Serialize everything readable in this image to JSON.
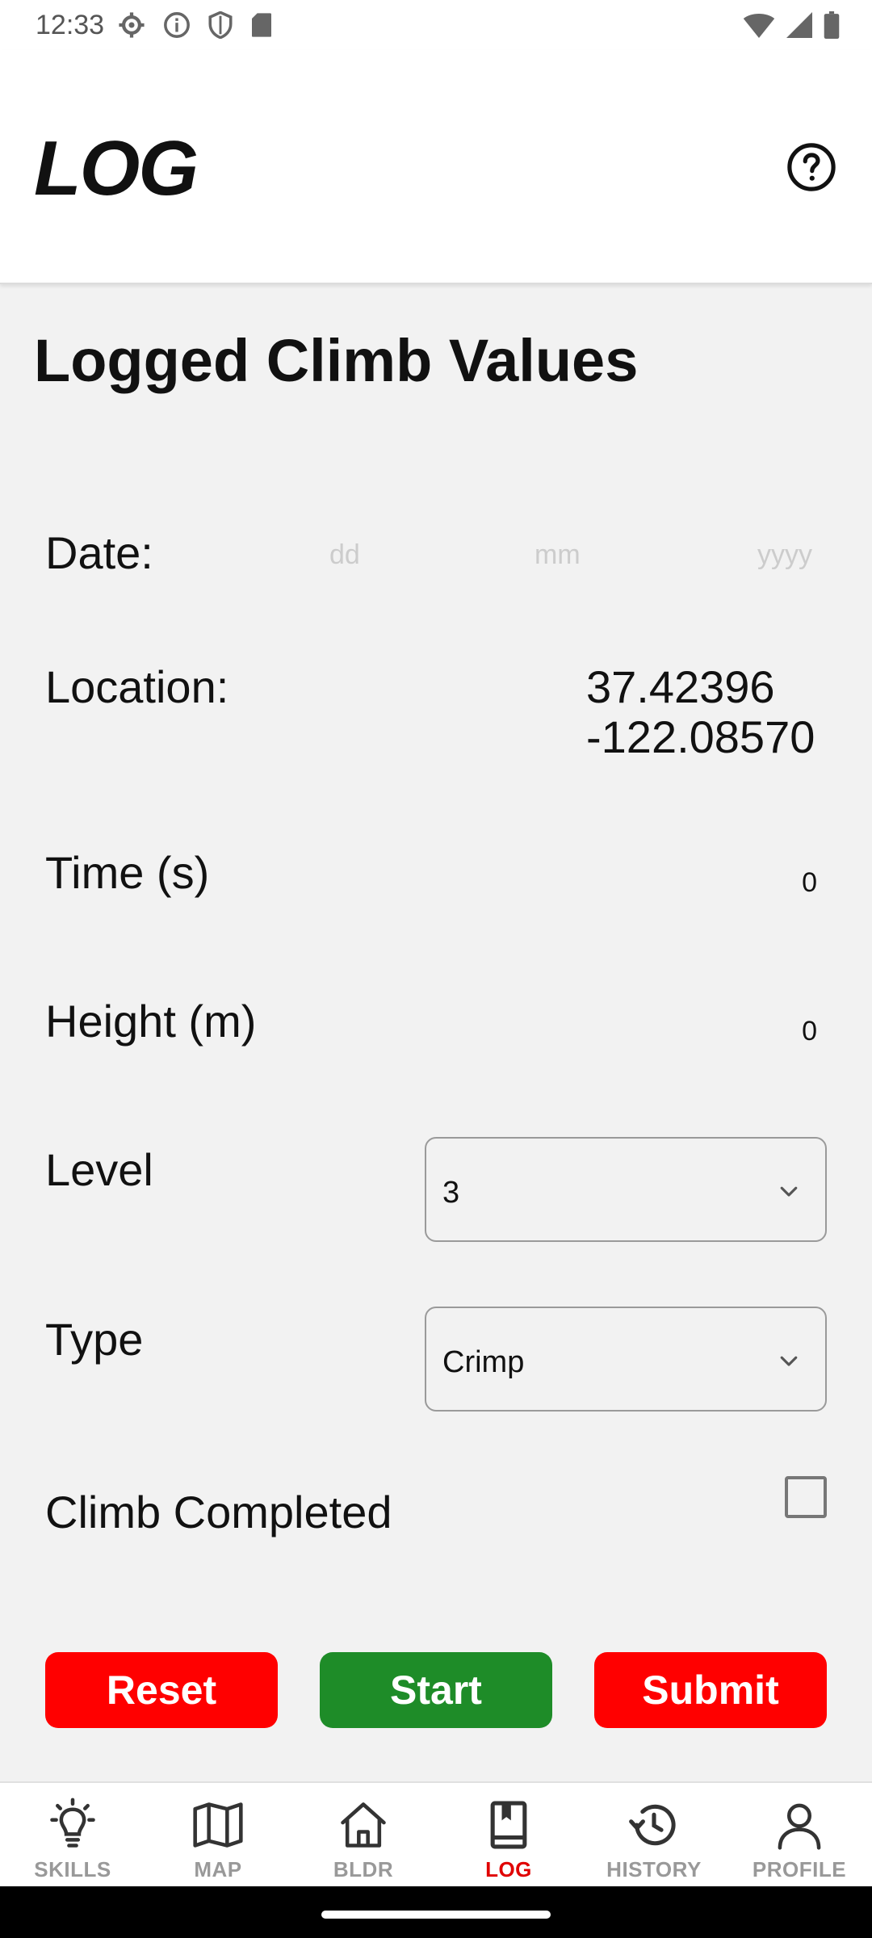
{
  "status_bar": {
    "time": "12:33",
    "left_icons": [
      "gear-icon",
      "info-icon",
      "shield-icon",
      "sd-card-icon"
    ],
    "right_icons": [
      "wifi-icon",
      "signal-icon",
      "battery-icon"
    ]
  },
  "header": {
    "title": "LOG",
    "help_icon": "help-circle-icon"
  },
  "form": {
    "title": "Logged Climb Values",
    "date": {
      "label": "Date:",
      "day_placeholder": "dd",
      "month_placeholder": "mm",
      "year_placeholder": "yyyy"
    },
    "location": {
      "label": "Location:",
      "latitude": "37.42396",
      "longitude": "-122.08570"
    },
    "time": {
      "label": "Time (s)",
      "value": "0"
    },
    "height": {
      "label": "Height (m)",
      "value": "0"
    },
    "level": {
      "label": "Level",
      "selected": "3"
    },
    "type": {
      "label": "Type",
      "selected": "Crimp"
    },
    "completed": {
      "label": "Climb Completed",
      "checked": false
    }
  },
  "buttons": {
    "reset": "Reset",
    "start": "Start",
    "submit": "Submit"
  },
  "colors": {
    "reset_button": "#ff0000",
    "start_button": "#1e8c28",
    "submit_button": "#ff0000",
    "active_nav": "#e00000",
    "inactive_nav": "#999999"
  },
  "bottom_nav": {
    "items": [
      {
        "label": "SKILLS",
        "icon": "lightbulb-icon"
      },
      {
        "label": "MAP",
        "icon": "map-icon"
      },
      {
        "label": "BLDR",
        "icon": "home-icon"
      },
      {
        "label": "LOG",
        "icon": "book-icon",
        "active": true
      },
      {
        "label": "HISTORY",
        "icon": "history-icon"
      },
      {
        "label": "PROFILE",
        "icon": "person-icon"
      }
    ]
  }
}
